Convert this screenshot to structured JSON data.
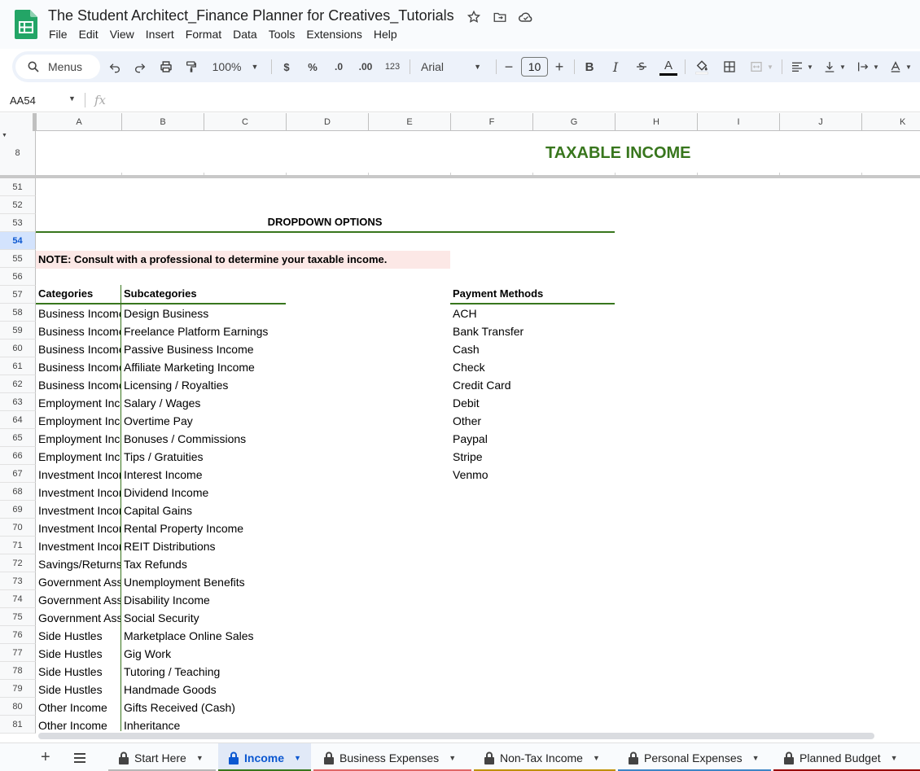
{
  "window": {
    "doc_title": "The Student Architect_Finance Planner for Creatives_Tutorials"
  },
  "menubar": [
    "File",
    "Edit",
    "View",
    "Insert",
    "Format",
    "Data",
    "Tools",
    "Extensions",
    "Help"
  ],
  "toolbar": {
    "search_label": "Menus",
    "zoom": "100%",
    "currency": "$",
    "percent": "%",
    "decrease_decimal": ".0",
    "increase_decimal": ".00",
    "number_format": "123",
    "font": "Arial",
    "font_size": "10",
    "bold": "B",
    "italic": "I",
    "text_color_letter": "A"
  },
  "formula_bar": {
    "cell_ref": "AA54",
    "fx": "fx"
  },
  "columns": [
    "A",
    "B",
    "C",
    "D",
    "E",
    "F",
    "G",
    "H",
    "I",
    "J",
    "K"
  ],
  "frozen_row": "8",
  "rows": [
    "51",
    "52",
    "53",
    "54",
    "55",
    "56",
    "57",
    "58",
    "59",
    "60",
    "61",
    "62",
    "63",
    "64",
    "65",
    "66",
    "67",
    "68",
    "69",
    "70",
    "71",
    "72",
    "73",
    "74",
    "75",
    "76",
    "77",
    "78",
    "79",
    "80",
    "81"
  ],
  "selected_row": "54",
  "sheet": {
    "title": "TAXABLE INCOME",
    "dropdown_title": "DROPDOWN OPTIONS",
    "note": "NOTE: Consult with a professional to determine your taxable income.",
    "headers": {
      "categories": "Categories",
      "subcategories": "Subcategories",
      "payment_methods": "Payment Methods"
    },
    "categories": [
      "Business Income",
      "Business Income",
      "Business Income",
      "Business Income",
      "Business Income",
      "Employment Income",
      "Employment Income",
      "Employment Income",
      "Employment Income",
      "Investment Income",
      "Investment Income",
      "Investment Income",
      "Investment Income",
      "Investment Income",
      "Savings/Returns",
      "Government Assistance",
      "Government Assistance",
      "Government Assistance",
      "Side Hustles",
      "Side Hustles",
      "Side Hustles",
      "Side Hustles",
      "Other Income",
      "Other Income"
    ],
    "subcategories": [
      "Design Business",
      "Freelance Platform Earnings",
      "Passive Business Income",
      "Affiliate Marketing Income",
      "Licensing / Royalties",
      "Salary / Wages",
      "Overtime Pay",
      "Bonuses / Commissions",
      "Tips / Gratuities",
      "Interest Income",
      "Dividend Income",
      "Capital Gains",
      "Rental Property Income",
      "REIT Distributions",
      "Tax Refunds",
      "Unemployment Benefits",
      "Disability Income",
      "Social Security",
      "Marketplace Online Sales",
      "Gig Work",
      "Tutoring / Teaching",
      "Handmade Goods",
      "Gifts Received (Cash)",
      "Inheritance"
    ],
    "payment_methods": [
      "ACH",
      "Bank Transfer",
      "Cash",
      "Check",
      "Credit Card",
      "Debit",
      "Other",
      "Paypal",
      "Stripe",
      "Venmo"
    ]
  },
  "sheet_tabs": [
    {
      "label": "Start Here",
      "active": false,
      "color": "#b7b7b7"
    },
    {
      "label": "Income",
      "active": true,
      "color": "#38761d"
    },
    {
      "label": "Business Expenses",
      "active": false,
      "color": "#e06666"
    },
    {
      "label": "Non-Tax Income",
      "active": false,
      "color": "#bf9000"
    },
    {
      "label": "Personal Expenses",
      "active": false,
      "color": "#3d85c6"
    },
    {
      "label": "Planned Budget",
      "active": false,
      "color": "#990000"
    }
  ],
  "colors": {
    "accent_green": "#38761d",
    "note_bg": "#fce8e6",
    "selection_blue": "#0b57d0"
  }
}
